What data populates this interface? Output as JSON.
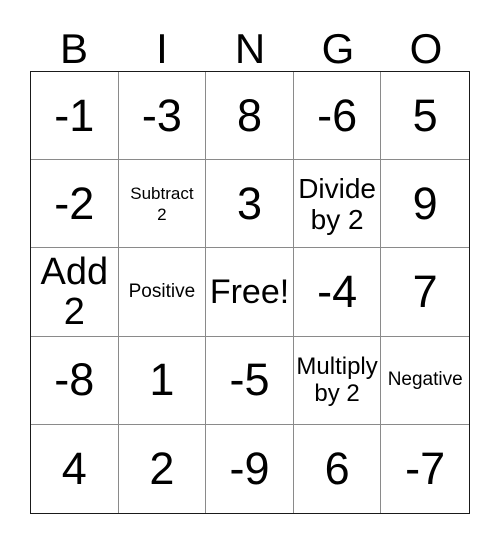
{
  "card": {
    "title": "BINGO",
    "header_letters": [
      "B",
      "I",
      "N",
      "G",
      "O"
    ],
    "free_space_label": "Free!",
    "colors": {
      "background": "#ffffff",
      "text": "#000000",
      "outer_border": "#1a1a1a",
      "inner_grid_line": "#8a8a8a"
    },
    "rows": [
      [
        {
          "text": "-1",
          "style": "num"
        },
        {
          "text": "-3",
          "style": "num"
        },
        {
          "text": "8",
          "style": "num"
        },
        {
          "text": "-6",
          "style": "num"
        },
        {
          "text": "5",
          "style": "num"
        }
      ],
      [
        {
          "text": "-2",
          "style": "num"
        },
        {
          "text": "Subtract\n2",
          "style": "small"
        },
        {
          "text": "3",
          "style": "num"
        },
        {
          "text": "Divide\nby 2",
          "style": "divide"
        },
        {
          "text": "9",
          "style": "num"
        }
      ],
      [
        {
          "text": "Add\n2",
          "style": "add"
        },
        {
          "text": "Positive",
          "style": "word"
        },
        {
          "text": "Free!",
          "style": "free"
        },
        {
          "text": "-4",
          "style": "num"
        },
        {
          "text": "7",
          "style": "num"
        }
      ],
      [
        {
          "text": "-8",
          "style": "num"
        },
        {
          "text": "1",
          "style": "num"
        },
        {
          "text": "-5",
          "style": "num"
        },
        {
          "text": "Multiply\nby 2",
          "style": "multiply"
        },
        {
          "text": "Negative",
          "style": "word"
        }
      ],
      [
        {
          "text": "4",
          "style": "num"
        },
        {
          "text": "2",
          "style": "num"
        },
        {
          "text": "-9",
          "style": "num"
        },
        {
          "text": "6",
          "style": "num"
        },
        {
          "text": "-7",
          "style": "num"
        }
      ]
    ]
  }
}
